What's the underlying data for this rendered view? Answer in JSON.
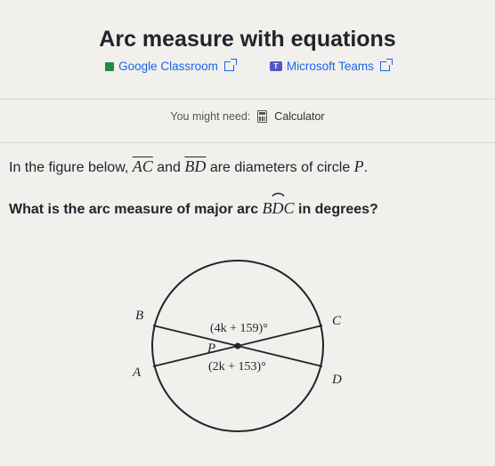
{
  "page": {
    "title": "Arc measure with equations"
  },
  "links": {
    "google_classroom": "Google Classroom",
    "microsoft_teams": "Microsoft Teams"
  },
  "helper": {
    "you_might_need": "You might need:",
    "calculator": "Calculator"
  },
  "problem": {
    "intro": "In the figure below, ",
    "segment1": "AC",
    "and": " and ",
    "segment2": "BD",
    "rest": " are diameters of circle ",
    "center": "P",
    "period": "."
  },
  "question": {
    "before": "What is the arc measure of major arc ",
    "arc": "BDC",
    "after": " in degrees?"
  },
  "figure": {
    "labels": {
      "B": "B",
      "C": "C",
      "A": "A",
      "D": "D",
      "P": "P"
    },
    "angle_top": "(4k + 159)°",
    "angle_bottom": "(2k + 153)°"
  },
  "colors": {
    "link": "#1865f2",
    "text": "#21242c",
    "background": "#f1f0ec"
  },
  "icons": [
    "google-classroom-icon",
    "external-link-icon",
    "microsoft-teams-icon",
    "calculator-icon"
  ]
}
